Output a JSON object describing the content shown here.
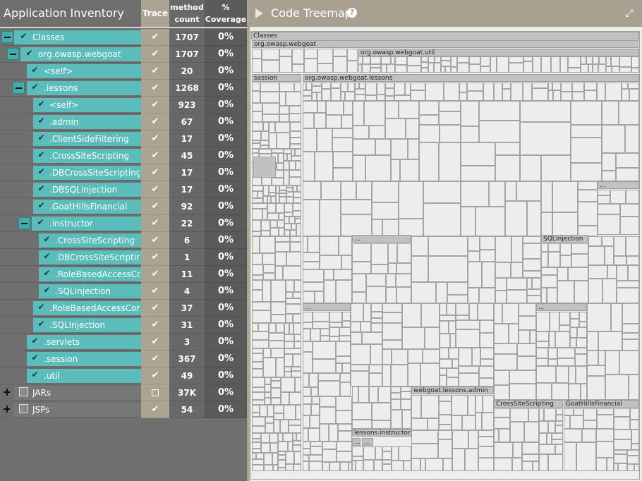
{
  "left_panel": {
    "title": "Application Inventory",
    "col_trace": "Trace",
    "col_count_1": "method",
    "col_count_2": "count",
    "col_cov_1": "%",
    "col_cov_2": "Coverage"
  },
  "rows": [
    {
      "name": "Classes",
      "count": "1707",
      "coverage": "0%"
    },
    {
      "name": "org.owasp.webgoat",
      "count": "1707",
      "coverage": "0%"
    },
    {
      "name": "<self>",
      "count": "20",
      "coverage": "0%"
    },
    {
      "name": ".lessons",
      "count": "1268",
      "coverage": "0%"
    },
    {
      "name": "<self>",
      "count": "923",
      "coverage": "0%"
    },
    {
      "name": ".admin",
      "count": "67",
      "coverage": "0%"
    },
    {
      "name": ".ClientSideFiltering",
      "count": "17",
      "coverage": "0%"
    },
    {
      "name": ".CrossSiteScripting",
      "count": "45",
      "coverage": "0%"
    },
    {
      "name": ".DBCrossSiteScripting",
      "count": "17",
      "coverage": "0%"
    },
    {
      "name": ".DBSQLInjection",
      "count": "17",
      "coverage": "0%"
    },
    {
      "name": ".GoatHillsFinancial",
      "count": "92",
      "coverage": "0%"
    },
    {
      "name": ".instructor",
      "count": "22",
      "coverage": "0%"
    },
    {
      "name": ".CrossSiteScripting",
      "count": "6",
      "coverage": "0%"
    },
    {
      "name": ".DBCrossSiteScripting",
      "count": "1",
      "coverage": "0%"
    },
    {
      "name": ".RoleBasedAccessCo...",
      "count": "11",
      "coverage": "0%"
    },
    {
      "name": ".SQLInjection",
      "count": "4",
      "coverage": "0%"
    },
    {
      "name": ".RoleBasedAccessCont...",
      "count": "37",
      "coverage": "0%"
    },
    {
      "name": ".SQLInjection",
      "count": "31",
      "coverage": "0%"
    },
    {
      "name": ".servlets",
      "count": "3",
      "coverage": "0%"
    },
    {
      "name": ".session",
      "count": "367",
      "coverage": "0%"
    },
    {
      "name": ".util",
      "count": "49",
      "coverage": "0%"
    },
    {
      "name": "JARs",
      "count": "37K",
      "coverage": "0%"
    },
    {
      "name": "JSPs",
      "count": "54",
      "coverage": "0%"
    }
  ],
  "treemap": {
    "title": "Code Treemap",
    "help": "?",
    "labels": {
      "classes": "Classes",
      "webgoat": "org.owasp.webgoat",
      "util": "org.owasp.webgoat.util",
      "session": "session",
      "lessons": "org.owasp.webgoat.lessons",
      "sqlinjection": "SQLInjection",
      "admin": "webgoat.lessons.admin",
      "xss": "CrossSiteScripting",
      "goathills": "GoatHillsFinancial",
      "instructor": "lessons.instructor",
      "ellipsis": "..."
    }
  }
}
